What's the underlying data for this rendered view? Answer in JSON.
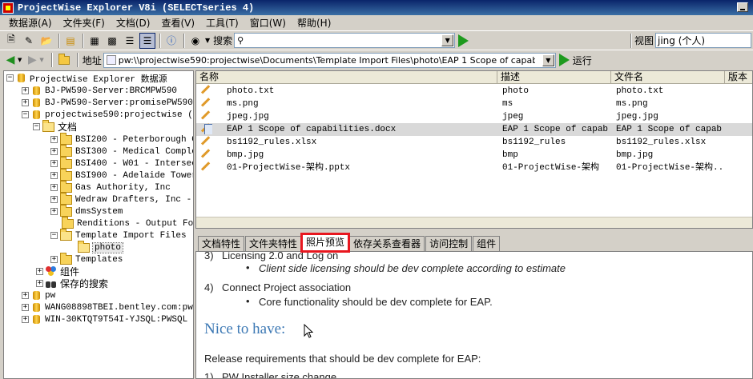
{
  "window": {
    "title": "ProjectWise Explorer V8i (SELECTseries 4)"
  },
  "menu": [
    "数据源(A)",
    "文件夹(F)",
    "文档(D)",
    "查看(V)",
    "工具(T)",
    "窗口(W)",
    "帮助(H)"
  ],
  "toolbar": {
    "search_label": "搜索",
    "search_value": "",
    "view_label": "视图",
    "view_value": "jing (个人)"
  },
  "address": {
    "label": "地址",
    "value": "pw:\\\\projectwise590:projectwise\\Documents\\Template Import Files\\photo\\EAP 1 Scope of capabilities.docx",
    "run_label": "运行"
  },
  "tree": {
    "root": "ProjectWise Explorer 数据源",
    "nodes": [
      {
        "label": "BJ-PW590-Server:BRCMPW590"
      },
      {
        "label": "BJ-PW590-Server:promisePW590"
      },
      {
        "label": "projectwise590:projectwise (adm"
      },
      {
        "label": "文档"
      },
      {
        "label": "BSI200 - Peterborough Geo"
      },
      {
        "label": "BSI300 - Medical Complex-"
      },
      {
        "label": "BSI400 - W01 - Intersecti"
      },
      {
        "label": "BSI900 - Adelaide Tower"
      },
      {
        "label": "Gas Authority, Inc"
      },
      {
        "label": "Wedraw Drafters, Inc -  N"
      },
      {
        "label": "dmsSystem"
      },
      {
        "label": "Renditions - Output Folde"
      },
      {
        "label": "Template Import Files"
      },
      {
        "label": "photo"
      },
      {
        "label": "Templates"
      },
      {
        "label": "组件"
      },
      {
        "label": "保存的搜索"
      },
      {
        "label": "pw"
      },
      {
        "label": "WANG08898TBEI.bentley.com:pw"
      },
      {
        "label": "WIN-30KTQT9T54I-YJSQL:PWSQL"
      }
    ]
  },
  "filelist": {
    "columns": [
      "名称",
      "描述",
      "文件名",
      "版本"
    ],
    "rows": [
      {
        "name": "photo.txt",
        "desc": "photo",
        "file": "photo.txt"
      },
      {
        "name": "ms.png",
        "desc": "ms",
        "file": "ms.png"
      },
      {
        "name": "jpeg.jpg",
        "desc": "jpeg",
        "file": "jpeg.jpg"
      },
      {
        "name": "EAP 1 Scope of capabilities.docx",
        "desc": "EAP 1 Scope of capab...",
        "file": "EAP 1 Scope of capab..."
      },
      {
        "name": "bs1192_rules.xlsx",
        "desc": "bs1192_rules",
        "file": "bs1192_rules.xlsx"
      },
      {
        "name": "bmp.jpg",
        "desc": "bmp",
        "file": "bmp.jpg"
      },
      {
        "name": "01-ProjectWise-架构.pptx",
        "desc": "01-ProjectWise-架构",
        "file": "01-ProjectWise-架构...."
      }
    ]
  },
  "tabs": [
    "文档特性",
    "文件夹特性",
    "照片预览",
    "依存关系查看器",
    "访问控制",
    "组件"
  ],
  "preview": {
    "item3_num": "3)",
    "item3_title": "Licensing 2.0 and Log on",
    "item3_bullet": "Client side licensing should be dev complete according to estimate",
    "item4_num": "4)",
    "item4_title": "Connect Project association",
    "item4_bullet": "Core functionality should be dev complete for EAP.",
    "heading": "Nice to have:",
    "release_text": "Release requirements that should be dev complete for EAP:",
    "item1_num": "1)",
    "item1_title": "PW Installer size change"
  }
}
